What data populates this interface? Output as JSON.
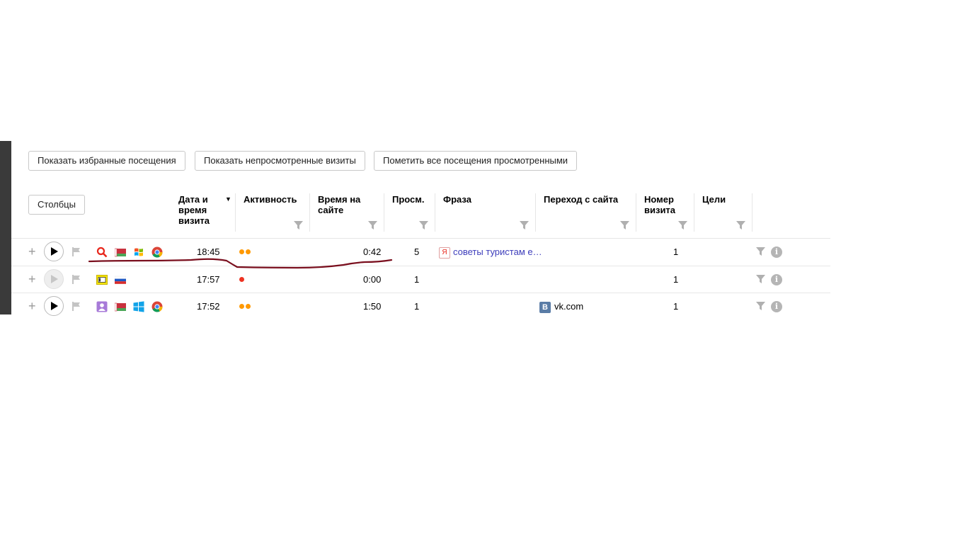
{
  "toolbar": {
    "show_favorites": "Показать избранные посещения",
    "show_unviewed": "Показать непросмотренные визиты",
    "mark_all_viewed": "Пометить все посещения просмотренными"
  },
  "columns_button": "Столбцы",
  "headers": {
    "datetime": "Дата и\nвремя\nвизита",
    "activity": "Активность",
    "time_on_site": "Время на\nсайте",
    "views": "Просм.",
    "phrase": "Фраза",
    "referrer": "Переход с сайта",
    "visit_number": "Номер\nвизита",
    "goals": "Цели"
  },
  "rows": [
    {
      "time": "18:45",
      "duration": "0:42",
      "views": "5",
      "phrase": "советы туристам е…",
      "phrase_source_badge": "Я",
      "referrer": "",
      "visit_number": "1",
      "activity_dots": [
        "#ff9900",
        "#ff9900"
      ]
    },
    {
      "time": "17:57",
      "duration": "0:00",
      "views": "1",
      "phrase": "",
      "referrer": "",
      "visit_number": "1",
      "activity_dots": [
        "#ee3322"
      ]
    },
    {
      "time": "17:52",
      "duration": "1:50",
      "views": "1",
      "phrase": "",
      "referrer": "vk.com",
      "referrer_badge": "B",
      "visit_number": "1",
      "activity_dots": [
        "#ff9900",
        "#ff9900"
      ]
    }
  ],
  "icons": {
    "row0": [
      "search-engine-icon",
      "belarus-flag-icon",
      "windows-xp-icon",
      "chrome-icon"
    ],
    "row1": [
      "direct-entry-icon",
      "russia-flag-icon"
    ],
    "row2": [
      "social-network-icon",
      "belarus-flag-icon",
      "windows-icon",
      "chrome-icon"
    ]
  },
  "colors": {
    "accent_orange": "#ff9900",
    "activity_red": "#ee3322",
    "link_blue": "#3d3dbb",
    "annotation": "#7a0f1e"
  }
}
